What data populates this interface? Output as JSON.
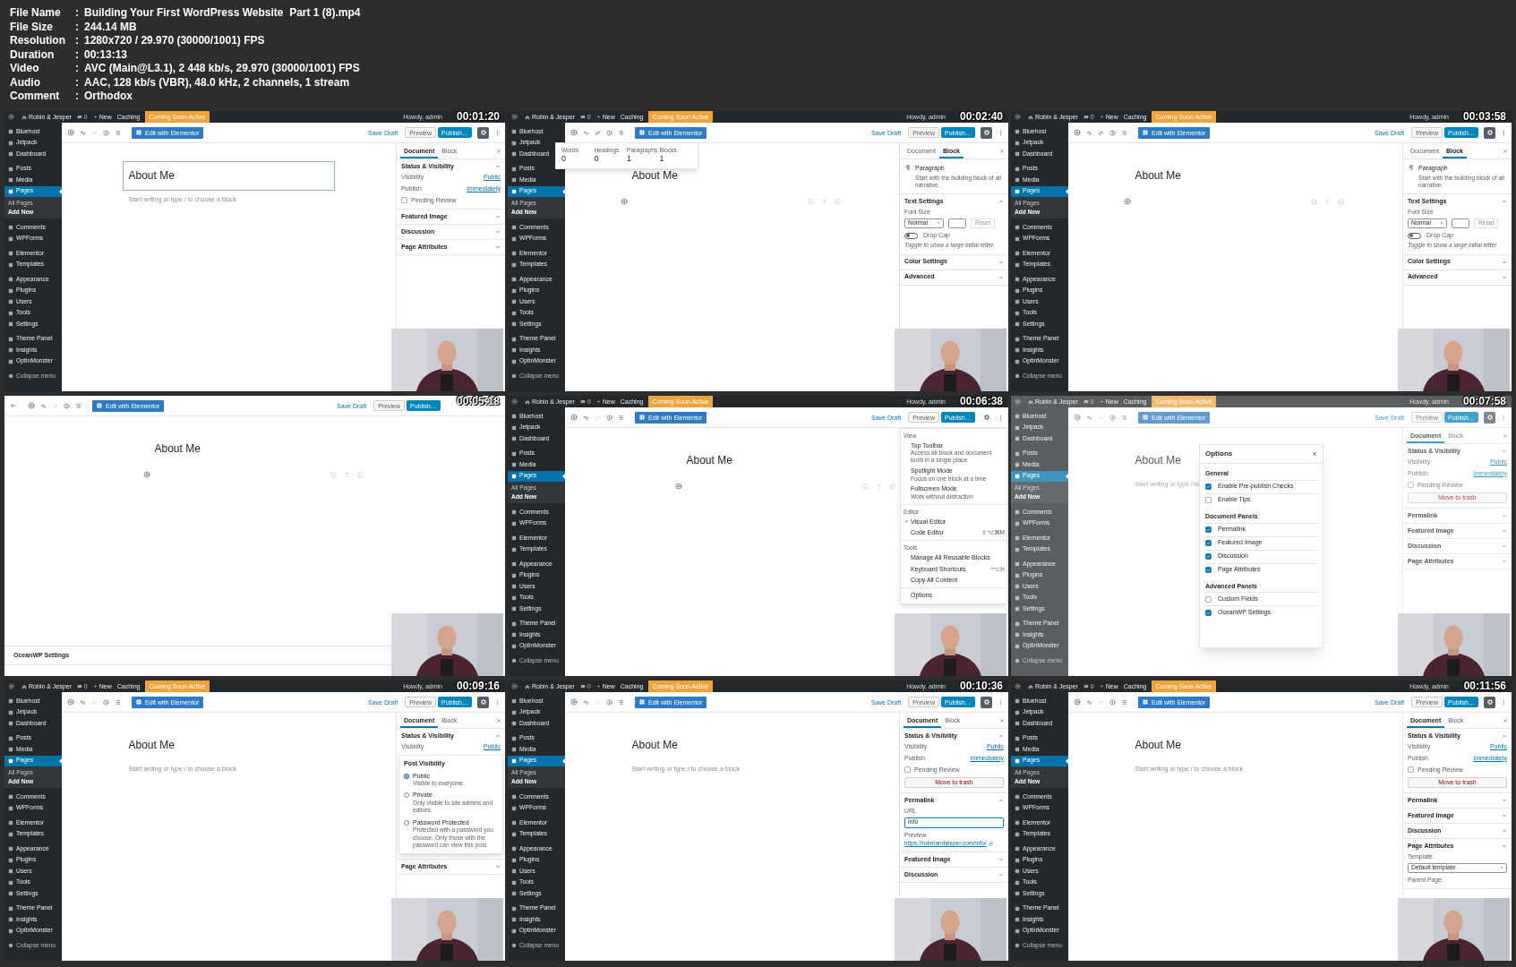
{
  "file_info": [
    {
      "label": "File Name",
      "separator": ":",
      "value": "Building Your First WordPress Website  Part 1 (8).mp4"
    },
    {
      "label": "File Size",
      "separator": ":",
      "value": "244.14 MB"
    },
    {
      "label": "Resolution",
      "separator": ":",
      "value": "1280x720 / 29.970 (30000/1001) FPS"
    },
    {
      "label": "Duration",
      "separator": ":",
      "value": "00:13:13"
    },
    {
      "label": "Video",
      "separator": ":",
      "value": "AVC (Main@L3.1), 2 448 kb/s, 29.970 (30000/1001) FPS"
    },
    {
      "label": "Audio",
      "separator": ":",
      "value": "AAC, 128 kb/s (VBR), 48.0 kHz, 2 channels, 1 stream"
    },
    {
      "label": "Comment",
      "separator": ":",
      "value": "Orthodox"
    }
  ],
  "frames": [
    {
      "timestamp": "00:01:20",
      "fullscreen": false,
      "dimmed": false,
      "admin_bar": {
        "site": "Robin & Jesper",
        "comments": "0",
        "new": "New",
        "caching": "Caching",
        "notice": "Coming Soon Active",
        "greeting": "Howdy, admin"
      },
      "admin_menu": {
        "groups": [
          [
            {
              "label": "Bluehost",
              "selected": false
            },
            {
              "label": "Jetpack",
              "selected": false
            },
            {
              "label": "Dashboard",
              "selected": false
            }
          ],
          [
            {
              "label": "Posts",
              "selected": false
            },
            {
              "label": "Media",
              "selected": false
            },
            {
              "label": "Pages",
              "selected": true,
              "children": [
                {
                  "label": "All Pages",
                  "selected": false
                },
                {
                  "label": "Add New",
                  "selected": true
                }
              ]
            }
          ],
          [
            {
              "label": "Comments",
              "selected": false
            },
            {
              "label": "WPForms",
              "selected": false
            }
          ],
          [
            {
              "label": "Elementor",
              "selected": false
            },
            {
              "label": "Templates",
              "selected": false
            }
          ],
          [
            {
              "label": "Appearance",
              "selected": false
            },
            {
              "label": "Plugins",
              "selected": false
            },
            {
              "label": "Users",
              "selected": false
            },
            {
              "label": "Tools",
              "selected": false
            },
            {
              "label": "Settings",
              "selected": false
            }
          ],
          [
            {
              "label": "Theme Panel",
              "selected": false
            },
            {
              "label": "Insights",
              "selected": false
            },
            {
              "label": "OptinMonster",
              "selected": false
            }
          ]
        ],
        "collapse": "Collapse menu"
      },
      "toolbar": {
        "elementor": "Edit with Elementor",
        "save_draft": "Save Draft",
        "preview": "Preview",
        "publish": "Publish…",
        "redo_enabled": false,
        "settings_open": true
      },
      "editor": {
        "title": "About Me",
        "title_selected": true,
        "block": {
          "kind": "placeholder",
          "text": "Start writing or type / to choose a block"
        }
      },
      "inspector": {
        "tabs": [
          {
            "label": "Document",
            "selected": true
          },
          {
            "label": "Block",
            "selected": false
          }
        ],
        "sections": [
          {
            "title": "Status & Visibility",
            "expanded": true,
            "rows": [
              {
                "kind": "setting",
                "label": "Visibility",
                "value": "Public"
              },
              {
                "kind": "setting",
                "label": "Publish",
                "value": "Immediately"
              },
              {
                "kind": "checkbox",
                "label": "Pending Review",
                "checked": false
              }
            ]
          },
          {
            "title": "Featured Image",
            "expanded": false
          },
          {
            "title": "Discussion",
            "expanded": false
          },
          {
            "title": "Page Attributes",
            "expanded": false
          }
        ]
      }
    },
    {
      "timestamp": "00:02:40",
      "fullscreen": false,
      "dimmed": false,
      "admin_bar": {
        "site": "Robin & Jesper",
        "comments": "0",
        "new": "New",
        "caching": "Caching",
        "notice": "Coming Soon Active",
        "greeting": "Howdy, admin"
      },
      "admin_menu": {
        "groups": [
          [
            {
              "label": "Bluehost",
              "selected": false
            },
            {
              "label": "Jetpack",
              "selected": false
            },
            {
              "label": "Dashboard",
              "selected": false
            }
          ],
          [
            {
              "label": "Posts",
              "selected": false
            },
            {
              "label": "Media",
              "selected": false
            },
            {
              "label": "Pages",
              "selected": true,
              "children": [
                {
                  "label": "All Pages",
                  "selected": false
                },
                {
                  "label": "Add New",
                  "selected": true
                }
              ]
            }
          ],
          [
            {
              "label": "Comments",
              "selected": false
            },
            {
              "label": "WPForms",
              "selected": false
            }
          ],
          [
            {
              "label": "Elementor",
              "selected": false
            },
            {
              "label": "Templates",
              "selected": false
            }
          ],
          [
            {
              "label": "Appearance",
              "selected": false
            },
            {
              "label": "Plugins",
              "selected": false
            },
            {
              "label": "Users",
              "selected": false
            },
            {
              "label": "Tools",
              "selected": false
            },
            {
              "label": "Settings",
              "selected": false
            }
          ],
          [
            {
              "label": "Theme Panel",
              "selected": false
            },
            {
              "label": "Insights",
              "selected": false
            },
            {
              "label": "OptinMonster",
              "selected": false
            }
          ]
        ],
        "collapse": "Collapse menu"
      },
      "toolbar": {
        "elementor": "Edit with Elementor",
        "save_draft": "Save Draft",
        "preview": "Preview",
        "publish": "Publish…",
        "redo_enabled": true,
        "settings_open": true
      },
      "editor": {
        "title": "About Me",
        "title_selected": false,
        "block": {
          "kind": "empty"
        }
      },
      "stats_popover": [
        {
          "label": "Words",
          "value": "0"
        },
        {
          "label": "Headings",
          "value": "0"
        },
        {
          "label": "Paragraphs",
          "value": "1"
        },
        {
          "label": "Blocks",
          "value": "1"
        }
      ],
      "inspector": {
        "tabs": [
          {
            "label": "Document",
            "selected": false
          },
          {
            "label": "Block",
            "selected": true
          }
        ],
        "sections": [
          {
            "rows": [
              {
                "kind": "block_card",
                "title": "Paragraph",
                "description": "Start with the building block of all narrative."
              }
            ]
          },
          {
            "title": "Text Settings",
            "expanded": true,
            "rows": [
              {
                "kind": "label",
                "text": "Font Size"
              },
              {
                "kind": "font_size",
                "value": "Normal",
                "reset": "Reset"
              },
              {
                "kind": "toggle",
                "label": "Drop Cap",
                "on": false,
                "help": "Toggle to show a large initial letter."
              }
            ]
          },
          {
            "title": "Color Settings",
            "expanded": false
          },
          {
            "title": "Advanced",
            "expanded": false
          }
        ]
      }
    },
    {
      "timestamp": "00:03:58",
      "fullscreen": false,
      "dimmed": false,
      "admin_bar": {
        "site": "Robin & Jesper",
        "comments": "0",
        "new": "New",
        "caching": "Caching",
        "notice": "Coming Soon Active",
        "greeting": "Howdy, admin"
      },
      "admin_menu": {
        "groups": [
          [
            {
              "label": "Bluehost",
              "selected": false
            },
            {
              "label": "Jetpack",
              "selected": false
            },
            {
              "label": "Dashboard",
              "selected": false
            }
          ],
          [
            {
              "label": "Posts",
              "selected": false
            },
            {
              "label": "Media",
              "selected": false
            },
            {
              "label": "Pages",
              "selected": true,
              "children": [
                {
                  "label": "All Pages",
                  "selected": false
                },
                {
                  "label": "Add New",
                  "selected": true
                }
              ]
            }
          ],
          [
            {
              "label": "Comments",
              "selected": false
            },
            {
              "label": "WPForms",
              "selected": false
            }
          ],
          [
            {
              "label": "Elementor",
              "selected": false
            },
            {
              "label": "Templates",
              "selected": false
            }
          ],
          [
            {
              "label": "Appearance",
              "selected": false
            },
            {
              "label": "Plugins",
              "selected": false
            },
            {
              "label": "Users",
              "selected": false
            },
            {
              "label": "Tools",
              "selected": false
            },
            {
              "label": "Settings",
              "selected": false
            }
          ],
          [
            {
              "label": "Theme Panel",
              "selected": false
            },
            {
              "label": "Insights",
              "selected": false
            },
            {
              "label": "OptinMonster",
              "selected": false
            }
          ]
        ],
        "collapse": "Collapse menu"
      },
      "toolbar": {
        "elementor": "Edit with Elementor",
        "save_draft": "Save Draft",
        "preview": "Preview",
        "publish": "Publish…",
        "redo_enabled": true,
        "settings_open": true
      },
      "editor": {
        "title": "About Me",
        "title_selected": false,
        "block": {
          "kind": "empty"
        }
      },
      "inspector": {
        "tabs": [
          {
            "label": "Document",
            "selected": false
          },
          {
            "label": "Block",
            "selected": true
          }
        ],
        "sections": [
          {
            "rows": [
              {
                "kind": "block_card",
                "title": "Paragraph",
                "description": "Start with the building block of all narrative."
              }
            ]
          },
          {
            "title": "Text Settings",
            "expanded": true,
            "rows": [
              {
                "kind": "label",
                "text": "Font Size"
              },
              {
                "kind": "font_size",
                "value": "Normal",
                "reset": "Reset"
              },
              {
                "kind": "toggle",
                "label": "Drop Cap",
                "on": false,
                "help": "Toggle to show a large initial letter."
              }
            ]
          },
          {
            "title": "Color Settings",
            "expanded": false
          },
          {
            "title": "Advanced",
            "expanded": false
          }
        ]
      }
    },
    {
      "timestamp": "00:05:18",
      "fullscreen": true,
      "dimmed": false,
      "toolbar": {
        "elementor": "Edit with Elementor",
        "save_draft": "Save Draft",
        "preview": "Preview",
        "publish": "Publish…",
        "redo_enabled": false
      },
      "editor": {
        "title": "About Me",
        "title_selected": false,
        "block": {
          "kind": "empty"
        }
      },
      "footer_panel": "OceanWP Settings"
    },
    {
      "timestamp": "00:06:38",
      "fullscreen": false,
      "dimmed": false,
      "admin_bar": {
        "site": "Robin & Jesper",
        "comments": "0",
        "new": "New",
        "caching": "Caching",
        "notice": "Coming Soon Active",
        "greeting": "Howdy, admin"
      },
      "admin_menu": {
        "groups": [
          [
            {
              "label": "Bluehost",
              "selected": false
            },
            {
              "label": "Jetpack",
              "selected": false
            },
            {
              "label": "Dashboard",
              "selected": false
            }
          ],
          [
            {
              "label": "Posts",
              "selected": false
            },
            {
              "label": "Media",
              "selected": false
            },
            {
              "label": "Pages",
              "selected": true,
              "children": [
                {
                  "label": "All Pages",
                  "selected": false
                },
                {
                  "label": "Add New",
                  "selected": true
                }
              ]
            }
          ],
          [
            {
              "label": "Comments",
              "selected": false
            },
            {
              "label": "WPForms",
              "selected": false
            }
          ],
          [
            {
              "label": "Elementor",
              "selected": false
            },
            {
              "label": "Templates",
              "selected": false
            }
          ],
          [
            {
              "label": "Appearance",
              "selected": false
            },
            {
              "label": "Plugins",
              "selected": false
            },
            {
              "label": "Users",
              "selected": false
            },
            {
              "label": "Tools",
              "selected": false
            },
            {
              "label": "Settings",
              "selected": false
            }
          ],
          [
            {
              "label": "Theme Panel",
              "selected": false
            },
            {
              "label": "Insights",
              "selected": false
            },
            {
              "label": "OptinMonster",
              "selected": false
            }
          ]
        ],
        "collapse": "Collapse menu"
      },
      "toolbar": {
        "elementor": "Edit with Elementor",
        "save_draft": "Save Draft",
        "preview": "Preview",
        "publish": "Publish…",
        "redo_enabled": false,
        "settings_open": false
      },
      "editor": {
        "title": "About Me",
        "title_selected": false,
        "block": {
          "kind": "empty"
        }
      },
      "more_menu": [
        {
          "title": "View",
          "items": [
            {
              "label": "Top Toolbar",
              "description": "Access all block and document tools in a single place"
            },
            {
              "label": "Spotlight Mode",
              "description": "Focus on one block at a time"
            },
            {
              "label": "Fullscreen Mode",
              "description": "Work without distraction"
            }
          ]
        },
        {
          "title": "Editor",
          "items": [
            {
              "label": "Visual Editor",
              "checked": true
            },
            {
              "label": "Code Editor",
              "checked": false,
              "shortcut": "⇧⌥⌘M"
            }
          ]
        },
        {
          "title": "Tools",
          "items": [
            {
              "label": "Manage All Reusable Blocks"
            },
            {
              "label": "Keyboard Shortcuts",
              "shortcut": "^⌥H"
            },
            {
              "label": "Copy All Content"
            }
          ]
        },
        {
          "items": [
            {
              "label": "Options"
            }
          ]
        }
      ]
    },
    {
      "timestamp": "00:07:58",
      "fullscreen": false,
      "dimmed": true,
      "admin_bar": {
        "site": "Robin & Jesper",
        "comments": "0",
        "new": "New",
        "caching": "Caching",
        "notice": "Coming Soon Active",
        "greeting": "Howdy, admin"
      },
      "admin_menu": {
        "groups": [
          [
            {
              "label": "Bluehost",
              "selected": false
            },
            {
              "label": "Jetpack",
              "selected": false
            },
            {
              "label": "Dashboard",
              "selected": false
            }
          ],
          [
            {
              "label": "Posts",
              "selected": false
            },
            {
              "label": "Media",
              "selected": false
            },
            {
              "label": "Pages",
              "selected": true,
              "children": [
                {
                  "label": "All Pages",
                  "selected": false
                },
                {
                  "label": "Add New",
                  "selected": true
                }
              ]
            }
          ],
          [
            {
              "label": "Comments",
              "selected": false
            },
            {
              "label": "WPForms",
              "selected": false
            }
          ],
          [
            {
              "label": "Elementor",
              "selected": false
            },
            {
              "label": "Templates",
              "selected": false
            }
          ],
          [
            {
              "label": "Appearance",
              "selected": false
            },
            {
              "label": "Plugins",
              "selected": false
            },
            {
              "label": "Users",
              "selected": false
            },
            {
              "label": "Tools",
              "selected": false
            },
            {
              "label": "Settings",
              "selected": false
            }
          ],
          [
            {
              "label": "Theme Panel",
              "selected": false
            },
            {
              "label": "Insights",
              "selected": false
            },
            {
              "label": "OptinMonster",
              "selected": false
            }
          ]
        ],
        "collapse": "Collapse menu"
      },
      "toolbar": {
        "elementor": "Edit with Elementor",
        "save_draft": "Save Draft",
        "preview": "Preview",
        "publish": "Publish…",
        "redo_enabled": false,
        "settings_open": true
      },
      "editor": {
        "title": "About Me",
        "title_selected": false,
        "block": {
          "kind": "placeholder",
          "text": "Start writing or type / to"
        }
      },
      "inspector": {
        "tabs": [
          {
            "label": "Document",
            "selected": true
          },
          {
            "label": "Block",
            "selected": false
          }
        ],
        "sections": [
          {
            "title": "Status & Visibility",
            "expanded": true,
            "rows": [
              {
                "kind": "setting",
                "label": "Visibility",
                "value": "Public"
              },
              {
                "kind": "setting",
                "label": "Publish",
                "value": "Immediately"
              },
              {
                "kind": "checkbox",
                "label": "Pending Review",
                "checked": false
              },
              {
                "kind": "button",
                "label": "Move to trash"
              }
            ]
          },
          {
            "title": "Permalink",
            "expanded": false
          },
          {
            "title": "Featured Image",
            "expanded": false
          },
          {
            "title": "Discussion",
            "expanded": false
          },
          {
            "title": "Page Attributes",
            "expanded": false
          }
        ]
      },
      "options_modal": {
        "title": "Options",
        "groups": [
          {
            "title": "General",
            "items": [
              {
                "label": "Enable Pre-publish Checks",
                "checked": true
              },
              {
                "label": "Enable Tips",
                "checked": false
              }
            ]
          },
          {
            "title": "Document Panels",
            "items": [
              {
                "label": "Permalink",
                "checked": true
              },
              {
                "label": "Featured Image",
                "checked": true
              },
              {
                "label": "Discussion",
                "checked": true
              },
              {
                "label": "Page Attributes",
                "checked": true
              }
            ]
          },
          {
            "title": "Advanced Panels",
            "items": [
              {
                "label": "Custom Fields",
                "checked": false
              },
              {
                "label": "OceanWP Settings",
                "checked": true
              }
            ]
          }
        ]
      }
    },
    {
      "timestamp": "00:09:16",
      "fullscreen": false,
      "dimmed": false,
      "admin_bar": {
        "site": "Robin & Jesper",
        "comments": "0",
        "new": "New",
        "caching": "Caching",
        "notice": "Coming Soon Active",
        "greeting": "Howdy, admin"
      },
      "admin_menu": {
        "groups": [
          [
            {
              "label": "Bluehost",
              "selected": false
            },
            {
              "label": "Jetpack",
              "selected": false
            },
            {
              "label": "Dashboard",
              "selected": false
            }
          ],
          [
            {
              "label": "Posts",
              "selected": false
            },
            {
              "label": "Media",
              "selected": false
            },
            {
              "label": "Pages",
              "selected": true,
              "children": [
                {
                  "label": "All Pages",
                  "selected": false
                },
                {
                  "label": "Add New",
                  "selected": true
                }
              ]
            }
          ],
          [
            {
              "label": "Comments",
              "selected": false
            },
            {
              "label": "WPForms",
              "selected": false
            }
          ],
          [
            {
              "label": "Elementor",
              "selected": false
            },
            {
              "label": "Templates",
              "selected": false
            }
          ],
          [
            {
              "label": "Appearance",
              "selected": false
            },
            {
              "label": "Plugins",
              "selected": false
            },
            {
              "label": "Users",
              "selected": false
            },
            {
              "label": "Tools",
              "selected": false
            },
            {
              "label": "Settings",
              "selected": false
            }
          ],
          [
            {
              "label": "Theme Panel",
              "selected": false
            },
            {
              "label": "Insights",
              "selected": false
            },
            {
              "label": "OptinMonster",
              "selected": false
            }
          ]
        ],
        "collapse": "Collapse menu"
      },
      "toolbar": {
        "elementor": "Edit with Elementor",
        "save_draft": "Save Draft",
        "preview": "Preview",
        "publish": "Publish…",
        "redo_enabled": false,
        "settings_open": true
      },
      "editor": {
        "title": "About Me",
        "title_selected": false,
        "block": {
          "kind": "placeholder",
          "text": "Start writing or type / to choose a block"
        }
      },
      "inspector": {
        "tabs": [
          {
            "label": "Document",
            "selected": true
          },
          {
            "label": "Block",
            "selected": false
          }
        ],
        "sections": [
          {
            "title": "Status & Visibility",
            "expanded": true,
            "rows": [
              {
                "kind": "setting",
                "label": "Visibility",
                "value": "Public"
              },
              {
                "kind": "visibility_popover",
                "title": "Post Visibility",
                "options": [
                  {
                    "label": "Public",
                    "description": "Visible to everyone.",
                    "selected": true
                  },
                  {
                    "label": "Private",
                    "description": "Only visible to site admins and editors.",
                    "selected": false
                  },
                  {
                    "label": "Password Protected",
                    "description": "Protected with a password you choose. Only those with the password can view this post.",
                    "selected": false
                  }
                ]
              }
            ]
          },
          {
            "title": "Page Attributes",
            "expanded": false
          }
        ]
      }
    },
    {
      "timestamp": "00:10:36",
      "fullscreen": false,
      "dimmed": false,
      "admin_bar": {
        "site": "Robin & Jesper",
        "comments": "0",
        "new": "New",
        "caching": "Caching",
        "notice": "Coming Soon Active",
        "greeting": "Howdy, admin"
      },
      "admin_menu": {
        "groups": [
          [
            {
              "label": "Bluehost",
              "selected": false
            },
            {
              "label": "Jetpack",
              "selected": false
            },
            {
              "label": "Dashboard",
              "selected": false
            }
          ],
          [
            {
              "label": "Posts",
              "selected": false
            },
            {
              "label": "Media",
              "selected": false
            },
            {
              "label": "Pages",
              "selected": true,
              "children": [
                {
                  "label": "All Pages",
                  "selected": false
                },
                {
                  "label": "Add New",
                  "selected": true
                }
              ]
            }
          ],
          [
            {
              "label": "Comments",
              "selected": false
            },
            {
              "label": "WPForms",
              "selected": false
            }
          ],
          [
            {
              "label": "Elementor",
              "selected": false
            },
            {
              "label": "Templates",
              "selected": false
            }
          ],
          [
            {
              "label": "Appearance",
              "selected": false
            },
            {
              "label": "Plugins",
              "selected": false
            },
            {
              "label": "Users",
              "selected": false
            },
            {
              "label": "Tools",
              "selected": false
            },
            {
              "label": "Settings",
              "selected": false
            }
          ],
          [
            {
              "label": "Theme Panel",
              "selected": false
            },
            {
              "label": "Insights",
              "selected": false
            },
            {
              "label": "OptinMonster",
              "selected": false
            }
          ]
        ],
        "collapse": "Collapse menu"
      },
      "toolbar": {
        "elementor": "Edit with Elementor",
        "save_draft": "Save Draft",
        "preview": "Preview",
        "publish": "Publish…",
        "redo_enabled": false,
        "settings_open": true
      },
      "editor": {
        "title": "About Me",
        "title_selected": false,
        "block": {
          "kind": "placeholder",
          "text": "Start writing or type / to choose a block"
        }
      },
      "inspector": {
        "tabs": [
          {
            "label": "Document",
            "selected": true
          },
          {
            "label": "Block",
            "selected": false
          }
        ],
        "sections": [
          {
            "title": "Status & Visibility",
            "expanded": true,
            "rows": [
              {
                "kind": "setting",
                "label": "Visibility",
                "value": "Public"
              },
              {
                "kind": "setting",
                "label": "Publish",
                "value": "Immediately"
              },
              {
                "kind": "checkbox",
                "label": "Pending Review",
                "checked": false
              },
              {
                "kind": "button",
                "label": "Move to trash"
              }
            ]
          },
          {
            "title": "Permalink",
            "expanded": true,
            "rows": [
              {
                "kind": "field",
                "label": "URL",
                "value": "info"
              },
              {
                "kind": "link",
                "label": "Preview",
                "url": "https://robinandjesper.com/info/"
              }
            ]
          },
          {
            "title": "Featured Image",
            "expanded": false
          },
          {
            "title": "Discussion",
            "expanded": false
          }
        ]
      }
    },
    {
      "timestamp": "00:11:56",
      "fullscreen": false,
      "dimmed": false,
      "admin_bar": {
        "site": "Robin & Jesper",
        "comments": "0",
        "new": "New",
        "caching": "Caching",
        "notice": "Coming Soon Active",
        "greeting": "Howdy, admin"
      },
      "admin_menu": {
        "groups": [
          [
            {
              "label": "Bluehost",
              "selected": false
            },
            {
              "label": "Jetpack",
              "selected": false
            },
            {
              "label": "Dashboard",
              "selected": false
            }
          ],
          [
            {
              "label": "Posts",
              "selected": false
            },
            {
              "label": "Media",
              "selected": false
            },
            {
              "label": "Pages",
              "selected": true,
              "children": [
                {
                  "label": "All Pages",
                  "selected": false
                },
                {
                  "label": "Add New",
                  "selected": true
                }
              ]
            }
          ],
          [
            {
              "label": "Comments",
              "selected": false
            },
            {
              "label": "WPForms",
              "selected": false
            }
          ],
          [
            {
              "label": "Elementor",
              "selected": false
            },
            {
              "label": "Templates",
              "selected": false
            }
          ],
          [
            {
              "label": "Appearance",
              "selected": false
            },
            {
              "label": "Plugins",
              "selected": false
            },
            {
              "label": "Users",
              "selected": false
            },
            {
              "label": "Tools",
              "selected": false
            },
            {
              "label": "Settings",
              "selected": false
            }
          ],
          [
            {
              "label": "Theme Panel",
              "selected": false
            },
            {
              "label": "Insights",
              "selected": false
            },
            {
              "label": "OptinMonster",
              "selected": false
            }
          ]
        ],
        "collapse": "Collapse menu"
      },
      "toolbar": {
        "elementor": "Edit with Elementor",
        "save_draft": "Save Draft",
        "preview": "Preview",
        "publish": "Publish…",
        "redo_enabled": false,
        "settings_open": true
      },
      "editor": {
        "title": "About Me",
        "title_selected": false,
        "block": {
          "kind": "placeholder",
          "text": "Start writing or type / to choose a block"
        }
      },
      "inspector": {
        "tabs": [
          {
            "label": "Document",
            "selected": true
          },
          {
            "label": "Block",
            "selected": false
          }
        ],
        "sections": [
          {
            "title": "Status & Visibility",
            "expanded": true,
            "rows": [
              {
                "kind": "setting",
                "label": "Visibility",
                "value": "Public"
              },
              {
                "kind": "setting",
                "label": "Publish",
                "value": "Immediately"
              },
              {
                "kind": "checkbox",
                "label": "Pending Review",
                "checked": false
              },
              {
                "kind": "button",
                "label": "Move to trash"
              }
            ]
          },
          {
            "title": "Permalink",
            "expanded": false
          },
          {
            "title": "Featured Image",
            "expanded": false
          },
          {
            "title": "Discussion",
            "expanded": false
          },
          {
            "title": "Page Attributes",
            "expanded": true,
            "rows": [
              {
                "kind": "select",
                "label": "Template:",
                "value": "Default template"
              },
              {
                "kind": "label",
                "text": "Parent Page:"
              }
            ]
          }
        ]
      }
    }
  ]
}
